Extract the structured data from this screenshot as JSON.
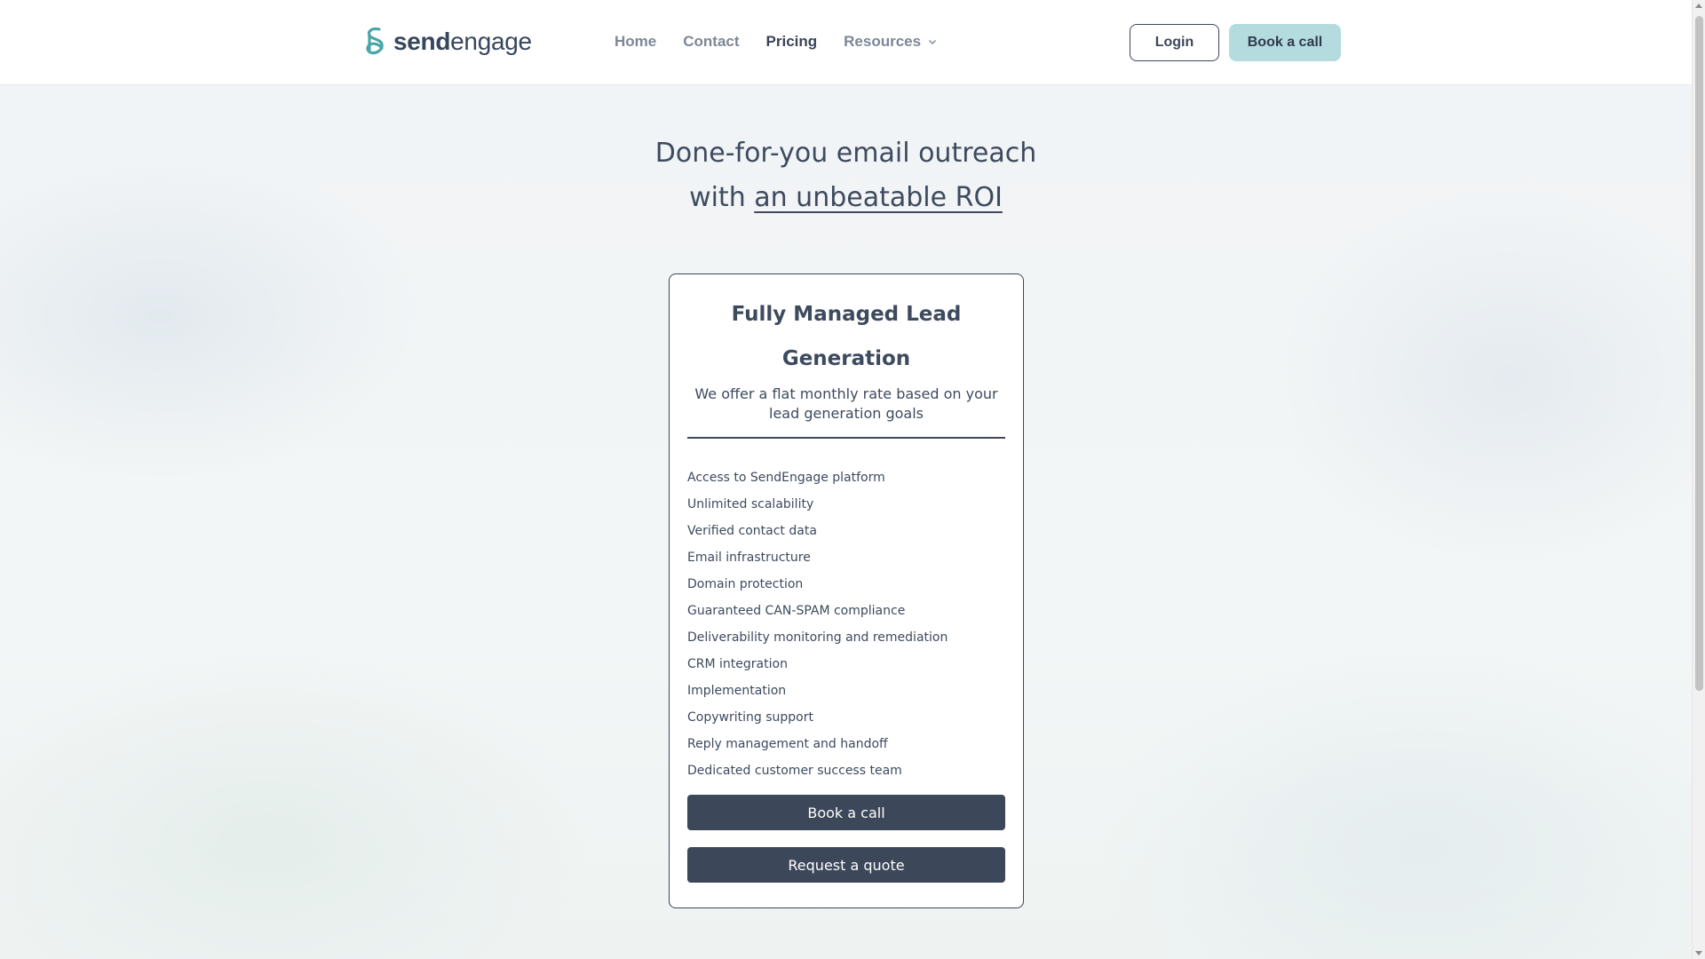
{
  "brand": {
    "logo_send": "send",
    "logo_engage": "engage",
    "logo_icon": "sendengage-logo-icon",
    "accent_color": "#b4dcde",
    "dark_color": "#3c475a",
    "logo_color": "#4aa5a8"
  },
  "nav": {
    "items": [
      {
        "label": "Home"
      },
      {
        "label": "Contact"
      },
      {
        "label": "Pricing",
        "active": true
      },
      {
        "label": "Resources",
        "icon": "chevron-down-icon"
      }
    ],
    "login_label": "Login",
    "book_call_label": "Book a call"
  },
  "hero": {
    "line1": "Done-for-you email outreach",
    "line2_prefix": "with ",
    "line2_link": "an unbeatable ROI"
  },
  "card": {
    "title": "Fully Managed Lead Generation",
    "subtitle": "We offer a flat monthly rate based on your lead generation goals",
    "features": [
      "Access to SendEngage platform",
      "Unlimited scalability",
      "Verified contact data",
      "Email infrastructure",
      "Domain protection",
      "Guaranteed CAN-SPAM compliance",
      "Deliverability monitoring and remediation",
      "CRM integration",
      "Implementation",
      "Copywriting support",
      "Reply management and handoff",
      "Dedicated customer success team"
    ],
    "book_call_label": "Book a call",
    "request_quote_label": "Request a quote"
  }
}
